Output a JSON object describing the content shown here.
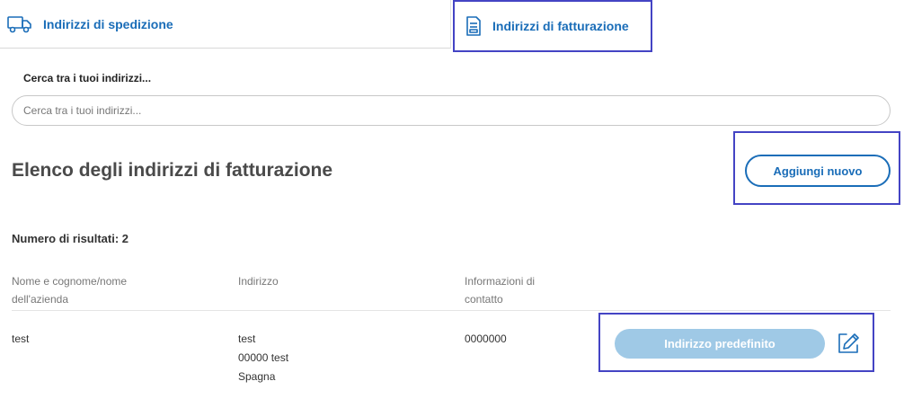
{
  "tabs": {
    "shipping_label": "Indirizzi di spedizione",
    "billing_label": "Indirizzi di fatturazione"
  },
  "search": {
    "label": "Cerca tra i tuoi indirizzi...",
    "placeholder": "Cerca tra i tuoi indirizzi...",
    "value": ""
  },
  "main": {
    "title": "Elenco degli indirizzi di fatturazione",
    "add_label": "Aggiungi nuovo",
    "results_count": "Numero di risultati: 2"
  },
  "table": {
    "headers": {
      "name": [
        "Nome e cognome/nome",
        "dell'azienda"
      ],
      "address": "Indirizzo",
      "contact": [
        "Informazioni di",
        "contatto"
      ]
    },
    "rows": [
      {
        "name": "test",
        "address": [
          "test",
          "00000 test",
          "Spagna"
        ],
        "contact": "0000000",
        "default_label": "Indirizzo predefinito"
      }
    ]
  },
  "icons": {
    "shipping": "truck-icon",
    "billing": "invoice-icon",
    "edit": "edit-icon"
  },
  "colors": {
    "accent": "#1a6db8",
    "highlight_frame": "#4444c4",
    "disabled_button": "#9fc9e6"
  }
}
